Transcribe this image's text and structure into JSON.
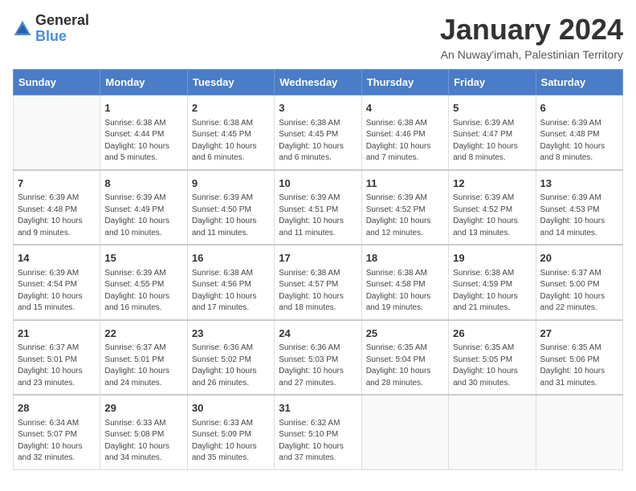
{
  "logo": {
    "text_general": "General",
    "text_blue": "Blue"
  },
  "title": "January 2024",
  "subtitle": "An Nuway'imah, Palestinian Territory",
  "days_of_week": [
    "Sunday",
    "Monday",
    "Tuesday",
    "Wednesday",
    "Thursday",
    "Friday",
    "Saturday"
  ],
  "weeks": [
    [
      {
        "day": "",
        "sunrise": "",
        "sunset": "",
        "daylight": ""
      },
      {
        "day": "1",
        "sunrise": "Sunrise: 6:38 AM",
        "sunset": "Sunset: 4:44 PM",
        "daylight": "Daylight: 10 hours and 5 minutes."
      },
      {
        "day": "2",
        "sunrise": "Sunrise: 6:38 AM",
        "sunset": "Sunset: 4:45 PM",
        "daylight": "Daylight: 10 hours and 6 minutes."
      },
      {
        "day": "3",
        "sunrise": "Sunrise: 6:38 AM",
        "sunset": "Sunset: 4:45 PM",
        "daylight": "Daylight: 10 hours and 6 minutes."
      },
      {
        "day": "4",
        "sunrise": "Sunrise: 6:38 AM",
        "sunset": "Sunset: 4:46 PM",
        "daylight": "Daylight: 10 hours and 7 minutes."
      },
      {
        "day": "5",
        "sunrise": "Sunrise: 6:39 AM",
        "sunset": "Sunset: 4:47 PM",
        "daylight": "Daylight: 10 hours and 8 minutes."
      },
      {
        "day": "6",
        "sunrise": "Sunrise: 6:39 AM",
        "sunset": "Sunset: 4:48 PM",
        "daylight": "Daylight: 10 hours and 8 minutes."
      }
    ],
    [
      {
        "day": "7",
        "sunrise": "Sunrise: 6:39 AM",
        "sunset": "Sunset: 4:48 PM",
        "daylight": "Daylight: 10 hours and 9 minutes."
      },
      {
        "day": "8",
        "sunrise": "Sunrise: 6:39 AM",
        "sunset": "Sunset: 4:49 PM",
        "daylight": "Daylight: 10 hours and 10 minutes."
      },
      {
        "day": "9",
        "sunrise": "Sunrise: 6:39 AM",
        "sunset": "Sunset: 4:50 PM",
        "daylight": "Daylight: 10 hours and 11 minutes."
      },
      {
        "day": "10",
        "sunrise": "Sunrise: 6:39 AM",
        "sunset": "Sunset: 4:51 PM",
        "daylight": "Daylight: 10 hours and 11 minutes."
      },
      {
        "day": "11",
        "sunrise": "Sunrise: 6:39 AM",
        "sunset": "Sunset: 4:52 PM",
        "daylight": "Daylight: 10 hours and 12 minutes."
      },
      {
        "day": "12",
        "sunrise": "Sunrise: 6:39 AM",
        "sunset": "Sunset: 4:52 PM",
        "daylight": "Daylight: 10 hours and 13 minutes."
      },
      {
        "day": "13",
        "sunrise": "Sunrise: 6:39 AM",
        "sunset": "Sunset: 4:53 PM",
        "daylight": "Daylight: 10 hours and 14 minutes."
      }
    ],
    [
      {
        "day": "14",
        "sunrise": "Sunrise: 6:39 AM",
        "sunset": "Sunset: 4:54 PM",
        "daylight": "Daylight: 10 hours and 15 minutes."
      },
      {
        "day": "15",
        "sunrise": "Sunrise: 6:39 AM",
        "sunset": "Sunset: 4:55 PM",
        "daylight": "Daylight: 10 hours and 16 minutes."
      },
      {
        "day": "16",
        "sunrise": "Sunrise: 6:38 AM",
        "sunset": "Sunset: 4:56 PM",
        "daylight": "Daylight: 10 hours and 17 minutes."
      },
      {
        "day": "17",
        "sunrise": "Sunrise: 6:38 AM",
        "sunset": "Sunset: 4:57 PM",
        "daylight": "Daylight: 10 hours and 18 minutes."
      },
      {
        "day": "18",
        "sunrise": "Sunrise: 6:38 AM",
        "sunset": "Sunset: 4:58 PM",
        "daylight": "Daylight: 10 hours and 19 minutes."
      },
      {
        "day": "19",
        "sunrise": "Sunrise: 6:38 AM",
        "sunset": "Sunset: 4:59 PM",
        "daylight": "Daylight: 10 hours and 21 minutes."
      },
      {
        "day": "20",
        "sunrise": "Sunrise: 6:37 AM",
        "sunset": "Sunset: 5:00 PM",
        "daylight": "Daylight: 10 hours and 22 minutes."
      }
    ],
    [
      {
        "day": "21",
        "sunrise": "Sunrise: 6:37 AM",
        "sunset": "Sunset: 5:01 PM",
        "daylight": "Daylight: 10 hours and 23 minutes."
      },
      {
        "day": "22",
        "sunrise": "Sunrise: 6:37 AM",
        "sunset": "Sunset: 5:01 PM",
        "daylight": "Daylight: 10 hours and 24 minutes."
      },
      {
        "day": "23",
        "sunrise": "Sunrise: 6:36 AM",
        "sunset": "Sunset: 5:02 PM",
        "daylight": "Daylight: 10 hours and 26 minutes."
      },
      {
        "day": "24",
        "sunrise": "Sunrise: 6:36 AM",
        "sunset": "Sunset: 5:03 PM",
        "daylight": "Daylight: 10 hours and 27 minutes."
      },
      {
        "day": "25",
        "sunrise": "Sunrise: 6:35 AM",
        "sunset": "Sunset: 5:04 PM",
        "daylight": "Daylight: 10 hours and 28 minutes."
      },
      {
        "day": "26",
        "sunrise": "Sunrise: 6:35 AM",
        "sunset": "Sunset: 5:05 PM",
        "daylight": "Daylight: 10 hours and 30 minutes."
      },
      {
        "day": "27",
        "sunrise": "Sunrise: 6:35 AM",
        "sunset": "Sunset: 5:06 PM",
        "daylight": "Daylight: 10 hours and 31 minutes."
      }
    ],
    [
      {
        "day": "28",
        "sunrise": "Sunrise: 6:34 AM",
        "sunset": "Sunset: 5:07 PM",
        "daylight": "Daylight: 10 hours and 32 minutes."
      },
      {
        "day": "29",
        "sunrise": "Sunrise: 6:33 AM",
        "sunset": "Sunset: 5:08 PM",
        "daylight": "Daylight: 10 hours and 34 minutes."
      },
      {
        "day": "30",
        "sunrise": "Sunrise: 6:33 AM",
        "sunset": "Sunset: 5:09 PM",
        "daylight": "Daylight: 10 hours and 35 minutes."
      },
      {
        "day": "31",
        "sunrise": "Sunrise: 6:32 AM",
        "sunset": "Sunset: 5:10 PM",
        "daylight": "Daylight: 10 hours and 37 minutes."
      },
      {
        "day": "",
        "sunrise": "",
        "sunset": "",
        "daylight": ""
      },
      {
        "day": "",
        "sunrise": "",
        "sunset": "",
        "daylight": ""
      },
      {
        "day": "",
        "sunrise": "",
        "sunset": "",
        "daylight": ""
      }
    ]
  ]
}
